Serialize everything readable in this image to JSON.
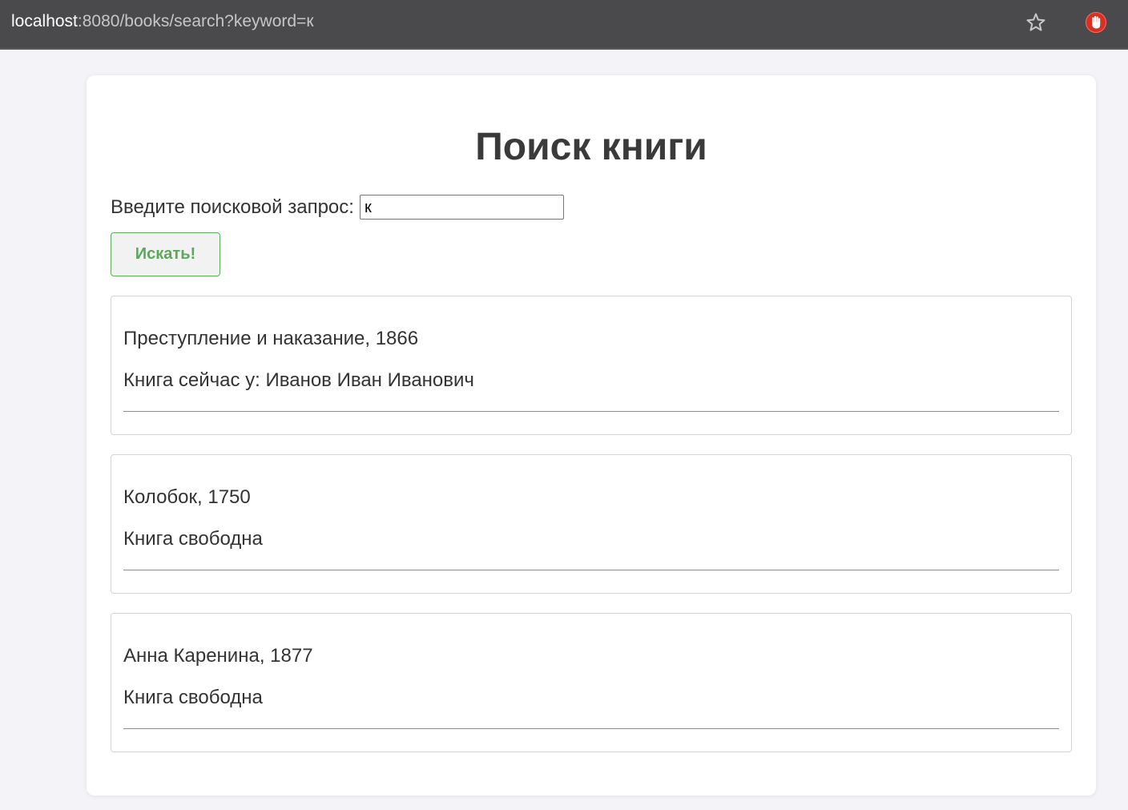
{
  "browser": {
    "url_host": "localhost",
    "url_path": ":8080/books/search?keyword=к",
    "star_icon": "star-outline-icon",
    "extension_icon": "hand-stop-icon",
    "extension_color": "#d93025"
  },
  "page": {
    "title": "Поиск книги",
    "search_label": "Введите поисковой запрос:",
    "search_value": "к",
    "search_button": "Искать!",
    "accent_color": "#5ba85b"
  },
  "results": [
    {
      "title": "Преступление и наказание, 1866",
      "status": "Книга сейчас у: Иванов Иван Иванович"
    },
    {
      "title": "Колобок, 1750",
      "status": "Книга свободна"
    },
    {
      "title": "Анна Каренина, 1877",
      "status": "Книга свободна"
    }
  ]
}
